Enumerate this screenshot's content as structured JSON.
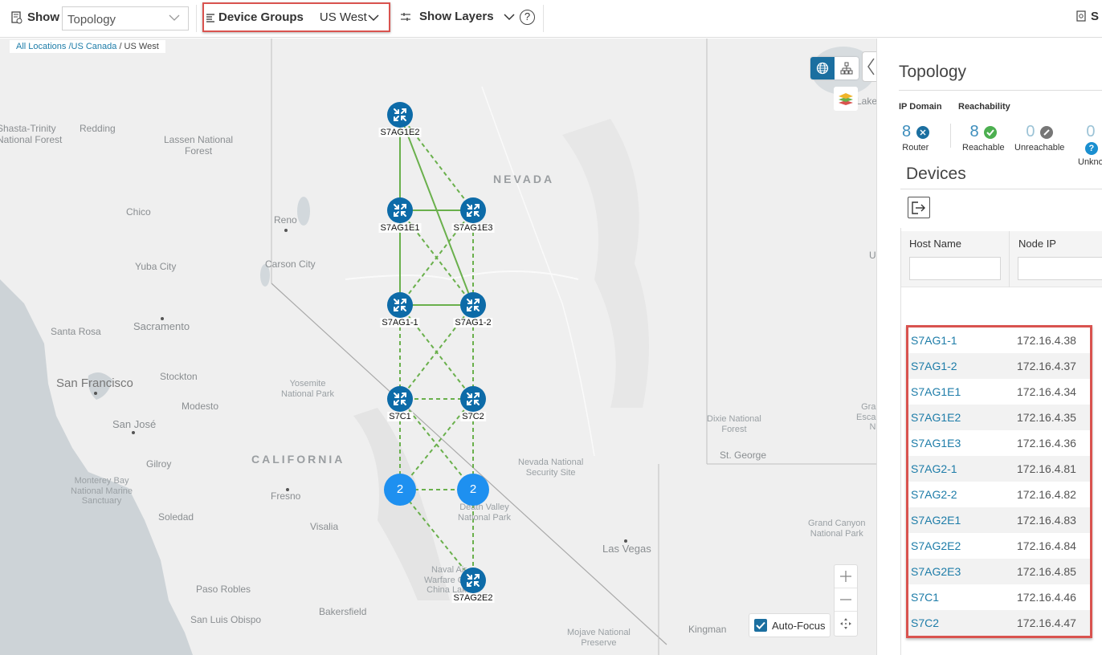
{
  "toolbar": {
    "show_label": "Show",
    "show_value": "Topology",
    "device_groups_label": "Device Groups",
    "device_groups_value": "US West",
    "show_layers_label": "Show Layers",
    "help_icon_glyph": "?",
    "right_partial_label": "S"
  },
  "breadcrumb": {
    "items": [
      "All Locations",
      "/US Canada",
      "/ US West"
    ]
  },
  "map": {
    "places": {
      "shasta": "Shasta-Trinity\nNational Forest",
      "redding": "Redding",
      "lassen": "Lassen National\nForest",
      "chico": "Chico",
      "reno": "Reno",
      "carson": "Carson City",
      "yuba": "Yuba City",
      "nevada": "NEVADA",
      "sacramento": "Sacramento",
      "santa_rosa": "Santa Rosa",
      "sf": "San Francisco",
      "stockton": "Stockton",
      "yosemite": "Yosemite\nNational Park",
      "modesto": "Modesto",
      "sanjose": "San José",
      "california": "CALIFORNIA",
      "gilroy": "Gilroy",
      "monterey": "Monterey Bay\nNational Marine\nSanctuary",
      "fresno": "Fresno",
      "soledad": "Soledad",
      "visalia": "Visalia",
      "paso": "Paso Robles",
      "slo": "San Luis Obispo",
      "bakersfield": "Bakersfield",
      "nnss": "Nevada National\nSecurity Site",
      "deathvalley": "Death Valley\nNational Park",
      "naval": "Naval Air\nWarfare Cen\nChina Lake",
      "lasvegas": "Las Vegas",
      "mojave": "Mojave National\nPreserve",
      "kingman": "Kingman",
      "dixie": "Dixie National\nForest",
      "stgeorge": "St. George",
      "grandcanyon": "Grand Canyon\nNational Park",
      "grandesc": "Gra\nEsca\nN",
      "lake": "Lake",
      "u": "U"
    },
    "nodes": [
      {
        "id": "S7AG1E2",
        "label": "S7AG1E2"
      },
      {
        "id": "S7AG1E1",
        "label": "S7AG1E1"
      },
      {
        "id": "S7AG1E3",
        "label": "S7AG1E3"
      },
      {
        "id": "S7AG1-1",
        "label": "S7AG1-1"
      },
      {
        "id": "S7AG1-2",
        "label": "S7AG1-2"
      },
      {
        "id": "S7C1",
        "label": "S7C1"
      },
      {
        "id": "S7C2",
        "label": "S7C2"
      },
      {
        "id": "S7AG2E2",
        "label": "S7AG2E2"
      }
    ],
    "clusters": [
      {
        "id": "cluster-left",
        "count": "2"
      },
      {
        "id": "cluster-right",
        "count": "2"
      }
    ],
    "links": [
      {
        "from": "S7AG1E2",
        "to": "S7AG1E1",
        "style": "solid"
      },
      {
        "from": "S7AG1E2",
        "to": "S7AG1-2",
        "style": "solid"
      },
      {
        "from": "S7AG1E2",
        "to": "S7AG1E3",
        "style": "dashed"
      },
      {
        "from": "S7AG1E1",
        "to": "S7AG1E3",
        "style": "solid"
      },
      {
        "from": "S7AG1E1",
        "to": "S7AG1-1",
        "style": "solid"
      },
      {
        "from": "S7AG1E1",
        "to": "S7AG1-2",
        "style": "dashed"
      },
      {
        "from": "S7AG1E3",
        "to": "S7AG1-1",
        "style": "dashed"
      },
      {
        "from": "S7AG1E3",
        "to": "S7AG1-2",
        "style": "dashed"
      },
      {
        "from": "S7AG1-1",
        "to": "S7AG1-2",
        "style": "solid"
      },
      {
        "from": "S7AG1-1",
        "to": "S7C1",
        "style": "dashed"
      },
      {
        "from": "S7AG1-1",
        "to": "S7C2",
        "style": "dashed"
      },
      {
        "from": "S7AG1-2",
        "to": "S7C1",
        "style": "dashed"
      },
      {
        "from": "S7AG1-2",
        "to": "S7C2",
        "style": "dashed"
      },
      {
        "from": "S7C1",
        "to": "S7C2",
        "style": "dashed"
      },
      {
        "from": "S7C1",
        "to": "cluster-left",
        "style": "dashed"
      },
      {
        "from": "S7C1",
        "to": "cluster-right",
        "style": "dashed"
      },
      {
        "from": "S7C2",
        "to": "cluster-left",
        "style": "dashed"
      },
      {
        "from": "S7C2",
        "to": "cluster-right",
        "style": "dashed"
      },
      {
        "from": "cluster-left",
        "to": "cluster-right",
        "style": "dashed"
      },
      {
        "from": "cluster-left",
        "to": "S7AG2E2",
        "style": "dashed"
      },
      {
        "from": "cluster-right",
        "to": "S7AG2E2",
        "style": "dashed"
      }
    ],
    "link_color": "#6ab04c",
    "node_color": "#0d6ba8",
    "cluster_color": "#1e90f0",
    "auto_focus_label": "Auto-Focus",
    "auto_focus_checked": true
  },
  "panel": {
    "title": "Topology",
    "ip_domain_header": "IP Domain",
    "reachability_header": "Reachability",
    "summary": [
      {
        "count": "8",
        "label": "Router",
        "icon": "router-icon",
        "color": "#1b6fa0"
      },
      {
        "count": "8",
        "label": "Reachable",
        "icon": "check-icon",
        "color": "#4caf50"
      },
      {
        "count": "0",
        "label": "Unreachable",
        "icon": "unreachable-icon",
        "color": "#777777"
      },
      {
        "count": "0",
        "label": "Unkno",
        "icon": "question-icon",
        "color": "#1a8fd0"
      }
    ],
    "devices_title": "Devices",
    "table": {
      "columns": [
        "Host Name",
        "Node IP"
      ],
      "rows": [
        {
          "host": "S7AG1-1",
          "ip": "172.16.4.38"
        },
        {
          "host": "S7AG1-2",
          "ip": "172.16.4.37"
        },
        {
          "host": "S7AG1E1",
          "ip": "172.16.4.34"
        },
        {
          "host": "S7AG1E2",
          "ip": "172.16.4.35"
        },
        {
          "host": "S7AG1E3",
          "ip": "172.16.4.36"
        },
        {
          "host": "S7AG2-1",
          "ip": "172.16.4.81"
        },
        {
          "host": "S7AG2-2",
          "ip": "172.16.4.82"
        },
        {
          "host": "S7AG2E1",
          "ip": "172.16.4.83"
        },
        {
          "host": "S7AG2E2",
          "ip": "172.16.4.84"
        },
        {
          "host": "S7AG2E3",
          "ip": "172.16.4.85"
        },
        {
          "host": "S7C1",
          "ip": "172.16.4.46"
        },
        {
          "host": "S7C2",
          "ip": "172.16.4.47"
        }
      ]
    }
  }
}
